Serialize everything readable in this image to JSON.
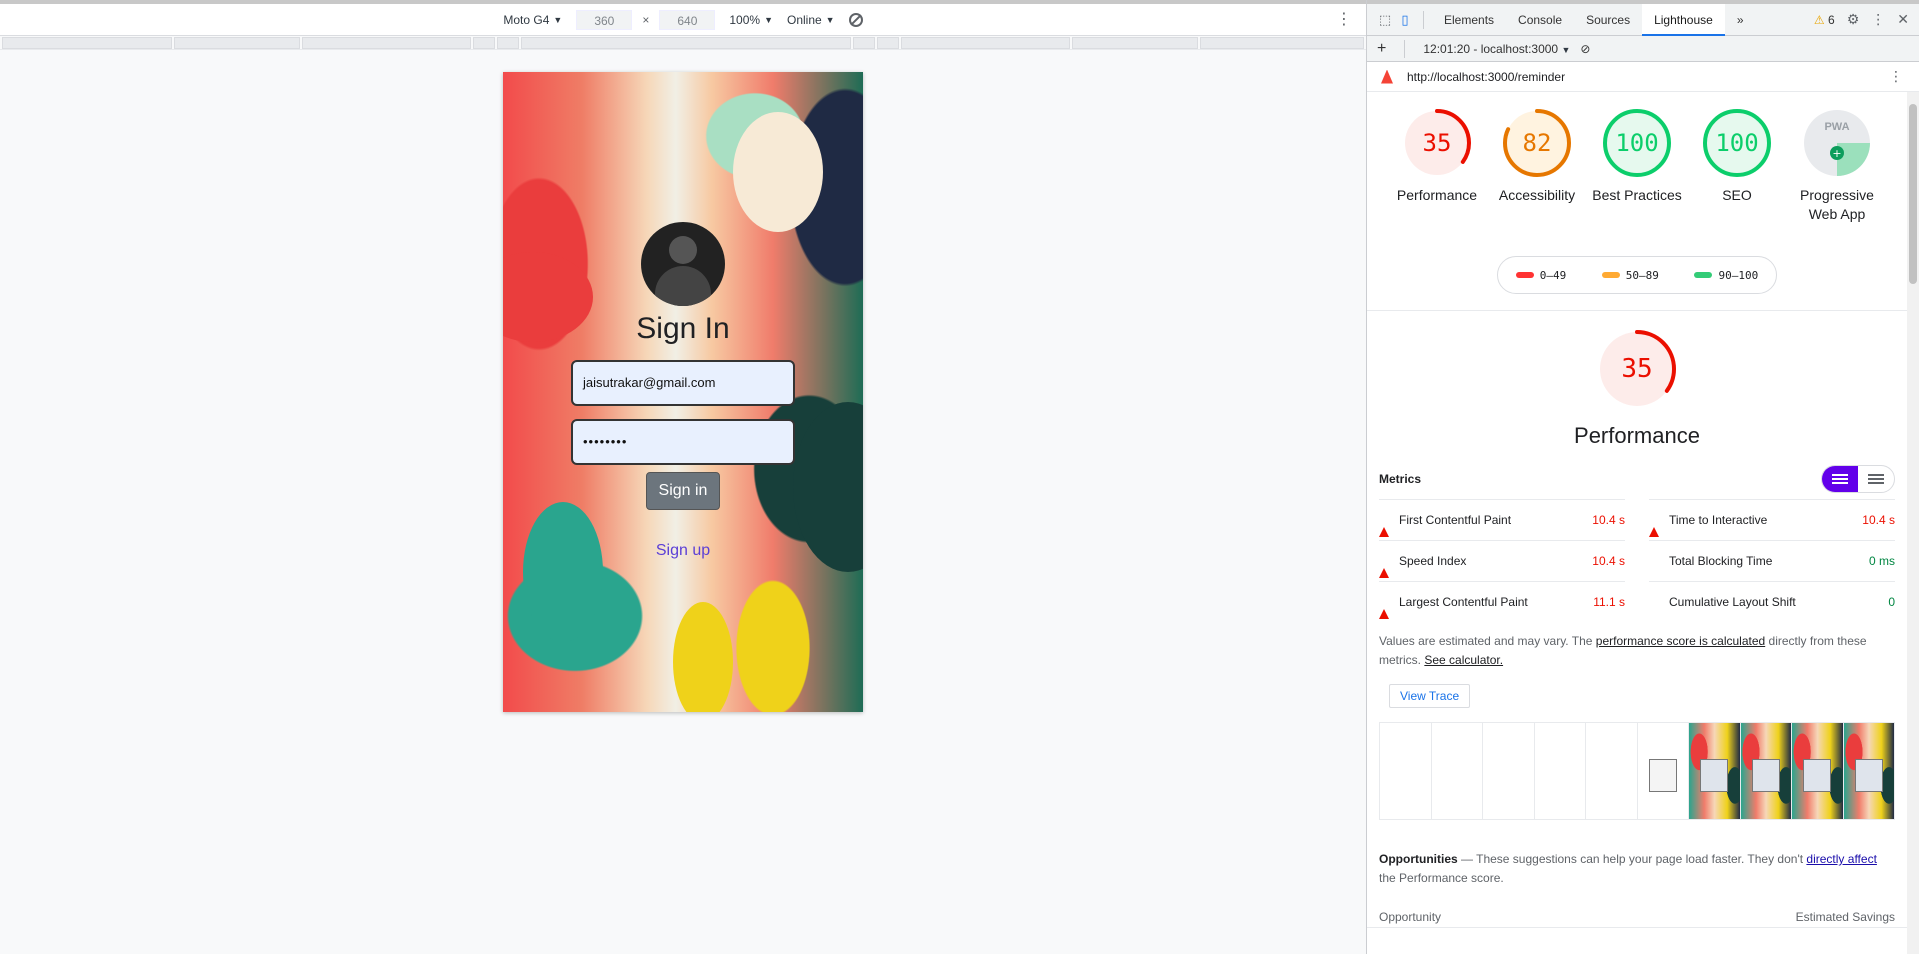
{
  "device_toolbar": {
    "device": "Moto G4",
    "width": "360",
    "height": "640",
    "zoom": "100%",
    "throttle": "Online",
    "x_sep": "×"
  },
  "phone": {
    "title": "Sign In",
    "email_value": "jaisutrakar@gmail.com",
    "password_value": "••••••••",
    "signin_label": "Sign in",
    "signup_label": "Sign up"
  },
  "devtools": {
    "tabs": [
      "Elements",
      "Console",
      "Sources",
      "Lighthouse"
    ],
    "active_tab": "Lighthouse",
    "more_tabs": "»",
    "warning_count": "6",
    "report_time": "12:01:20 - localhost:3000",
    "url": "http://localhost:3000/reminder"
  },
  "scores": [
    {
      "label": "Performance",
      "score": "35",
      "color": "#eb0f00",
      "bg": "#fdecea"
    },
    {
      "label": "Accessibility",
      "score": "82",
      "color": "#e67700",
      "bg": "#fff3e0"
    },
    {
      "label": "Best Practices",
      "score": "100",
      "color": "#0cce6b",
      "bg": "#e6f9ee"
    },
    {
      "label": "SEO",
      "score": "100",
      "color": "#0cce6b",
      "bg": "#e6f9ee"
    },
    {
      "label": "Progressive Web App",
      "score": "PWA",
      "color": "#9aa0a6",
      "bg": "#e8eaed"
    }
  ],
  "legend": [
    {
      "range": "0–49",
      "color": "#ff3333"
    },
    {
      "range": "50–89",
      "color": "#ffaa33"
    },
    {
      "range": "90–100",
      "color": "#33cc77"
    }
  ],
  "performance": {
    "score": "35",
    "title": "Performance",
    "metrics_label": "Metrics",
    "metrics": [
      {
        "name": "First Contentful Paint",
        "value": "10.4 s",
        "status": "bad"
      },
      {
        "name": "Time to Interactive",
        "value": "10.4 s",
        "status": "bad"
      },
      {
        "name": "Speed Index",
        "value": "10.4 s",
        "status": "bad"
      },
      {
        "name": "Total Blocking Time",
        "value": "0 ms",
        "status": "good"
      },
      {
        "name": "Largest Contentful Paint",
        "value": "11.1 s",
        "status": "bad"
      },
      {
        "name": "Cumulative Layout Shift",
        "value": "0",
        "status": "good"
      }
    ],
    "note_pre": "Values are estimated and may vary. The ",
    "note_link1": "performance score is calculated",
    "note_mid": " directly from these metrics. ",
    "note_link2": "See calculator.",
    "view_trace": "View Trace"
  },
  "opportunities": {
    "heading": "Opportunities",
    "dash": " — ",
    "text_pre": "These suggestions can help your page load faster. They don't ",
    "link": "directly affect",
    "text_post": " the Performance score.",
    "col_opportunity": "Opportunity",
    "col_savings": "Estimated Savings"
  }
}
